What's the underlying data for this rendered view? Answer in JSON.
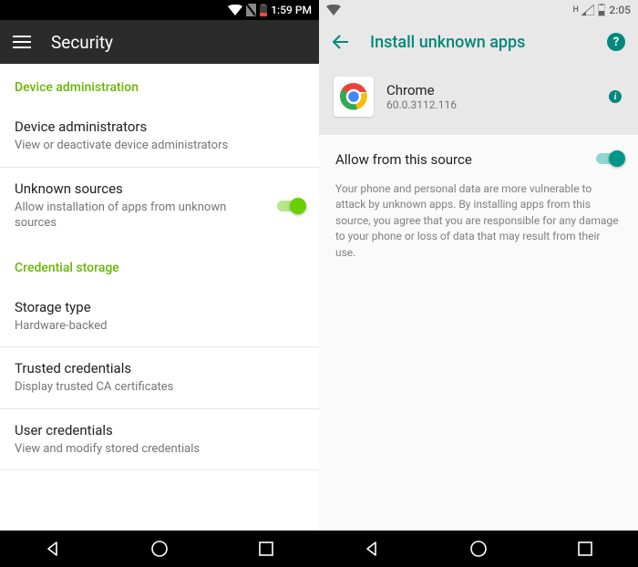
{
  "left": {
    "status": {
      "time": "1:59 PM"
    },
    "appbar": {
      "title": "Security"
    },
    "sections": {
      "device_admin": {
        "header": "Device administration",
        "items": [
          {
            "title": "Device administrators",
            "sub": "View or deactivate device administrators"
          },
          {
            "title": "Unknown sources",
            "sub": "Allow installation of apps from unknown sources"
          }
        ]
      },
      "cred_storage": {
        "header": "Credential storage",
        "items": [
          {
            "title": "Storage type",
            "sub": "Hardware-backed"
          },
          {
            "title": "Trusted credentials",
            "sub": "Display trusted CA certificates"
          },
          {
            "title": "User credentials",
            "sub": "View and modify stored credentials"
          }
        ]
      }
    }
  },
  "right": {
    "status": {
      "time": "2:05"
    },
    "appbar": {
      "title": "Install unknown apps"
    },
    "app": {
      "name": "Chrome",
      "version": "60.0.3112.116"
    },
    "setting": {
      "title": "Allow from this source"
    },
    "desc": "Your phone and personal data are more vulnerable to attack by unknown apps. By installing apps from this source, you agree that you are responsible for any damage to your phone or loss of data that may result from their use."
  }
}
